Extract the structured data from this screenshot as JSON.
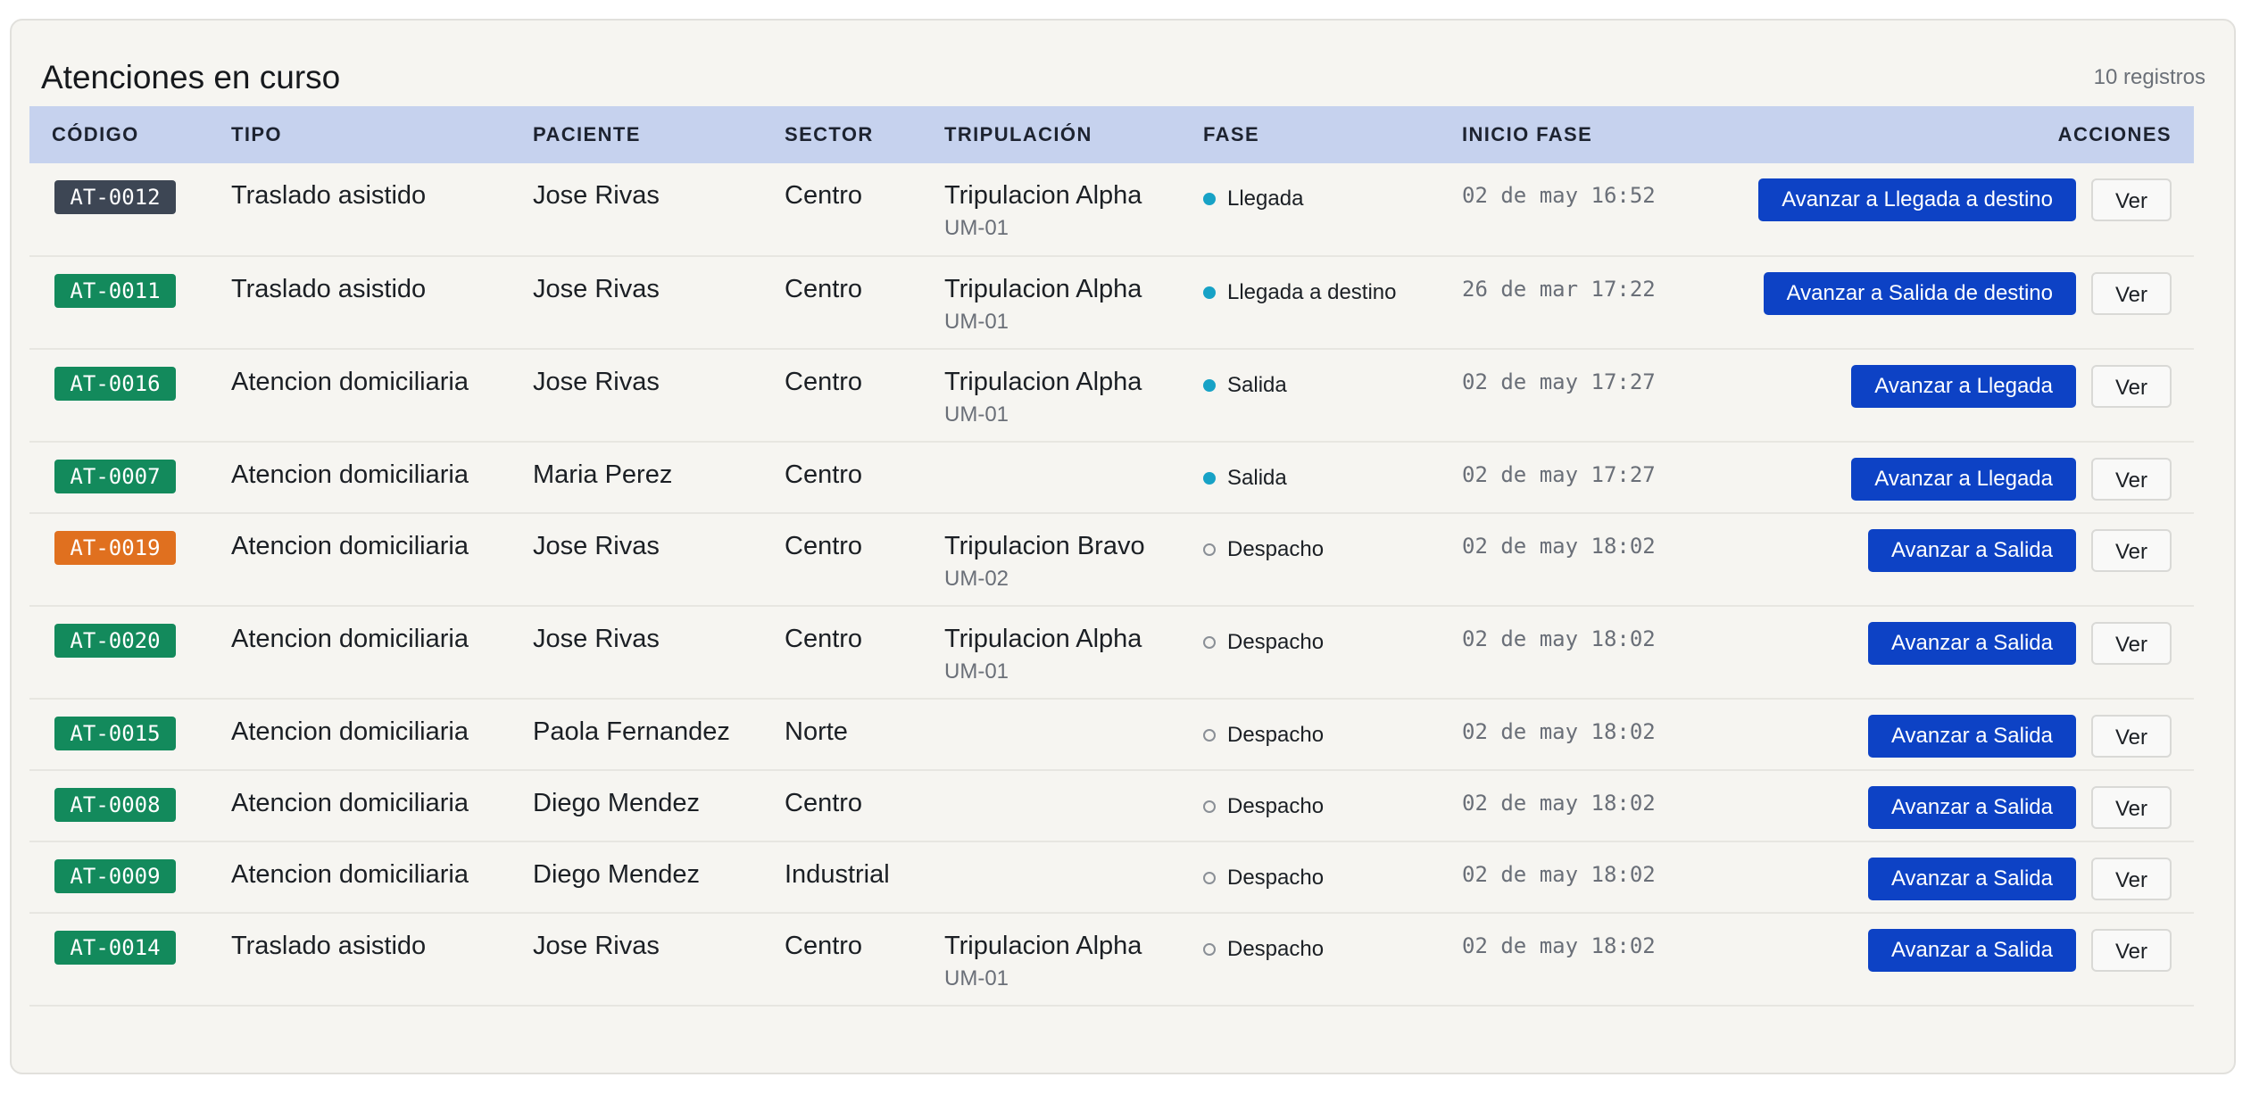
{
  "header": {
    "title": "Atenciones en curso",
    "count": "10 registros"
  },
  "columns": {
    "code": "CÓDIGO",
    "type": "TIPO",
    "patient": "PACIENTE",
    "sector": "SECTOR",
    "crew": "TRIPULACIÓN",
    "phase": "FASE",
    "start": "INICIO FASE",
    "actions": "ACCIONES"
  },
  "colors": {
    "badge_dark": "#3d4654",
    "badge_green": "#138a5c",
    "badge_orange": "#e0701f",
    "primary": "#0d42c5",
    "header_bg": "#c6d2ee",
    "phase_active": "#17a2c6"
  },
  "view_label": "Ver",
  "rows": [
    {
      "code": "AT-0012",
      "badge": "dark",
      "type": "Traslado asistido",
      "patient": "Jose Rivas",
      "sector": "Centro",
      "crew": "Tripulacion Alpha",
      "unit": "UM-01",
      "phase": "Llegada",
      "phase_state": "active",
      "start": "02 de may 16:52",
      "action": "Avanzar a Llegada a destino"
    },
    {
      "code": "AT-0011",
      "badge": "green",
      "type": "Traslado asistido",
      "patient": "Jose Rivas",
      "sector": "Centro",
      "crew": "Tripulacion Alpha",
      "unit": "UM-01",
      "phase": "Llegada a destino",
      "phase_state": "active",
      "start": "26 de mar 17:22",
      "action": "Avanzar a Salida de destino"
    },
    {
      "code": "AT-0016",
      "badge": "green",
      "type": "Atencion domiciliaria",
      "patient": "Jose Rivas",
      "sector": "Centro",
      "crew": "Tripulacion Alpha",
      "unit": "UM-01",
      "phase": "Salida",
      "phase_state": "active",
      "start": "02 de may 17:27",
      "action": "Avanzar a Llegada"
    },
    {
      "code": "AT-0007",
      "badge": "green",
      "type": "Atencion domiciliaria",
      "patient": "Maria Perez",
      "sector": "Centro",
      "crew": "",
      "unit": "",
      "phase": "Salida",
      "phase_state": "active",
      "start": "02 de may 17:27",
      "action": "Avanzar a Llegada"
    },
    {
      "code": "AT-0019",
      "badge": "orange",
      "type": "Atencion domiciliaria",
      "patient": "Jose Rivas",
      "sector": "Centro",
      "crew": "Tripulacion Bravo",
      "unit": "UM-02",
      "phase": "Despacho",
      "phase_state": "pending",
      "start": "02 de may 18:02",
      "action": "Avanzar a Salida"
    },
    {
      "code": "AT-0020",
      "badge": "green",
      "type": "Atencion domiciliaria",
      "patient": "Jose Rivas",
      "sector": "Centro",
      "crew": "Tripulacion Alpha",
      "unit": "UM-01",
      "phase": "Despacho",
      "phase_state": "pending",
      "start": "02 de may 18:02",
      "action": "Avanzar a Salida"
    },
    {
      "code": "AT-0015",
      "badge": "green",
      "type": "Atencion domiciliaria",
      "patient": "Paola Fernandez",
      "sector": "Norte",
      "crew": "",
      "unit": "",
      "phase": "Despacho",
      "phase_state": "pending",
      "start": "02 de may 18:02",
      "action": "Avanzar a Salida"
    },
    {
      "code": "AT-0008",
      "badge": "green",
      "type": "Atencion domiciliaria",
      "patient": "Diego Mendez",
      "sector": "Centro",
      "crew": "",
      "unit": "",
      "phase": "Despacho",
      "phase_state": "pending",
      "start": "02 de may 18:02",
      "action": "Avanzar a Salida"
    },
    {
      "code": "AT-0009",
      "badge": "green",
      "type": "Atencion domiciliaria",
      "patient": "Diego Mendez",
      "sector": "Industrial",
      "crew": "",
      "unit": "",
      "phase": "Despacho",
      "phase_state": "pending",
      "start": "02 de may 18:02",
      "action": "Avanzar a Salida"
    },
    {
      "code": "AT-0014",
      "badge": "green",
      "type": "Traslado asistido",
      "patient": "Jose Rivas",
      "sector": "Centro",
      "crew": "Tripulacion Alpha",
      "unit": "UM-01",
      "phase": "Despacho",
      "phase_state": "pending",
      "start": "02 de may 18:02",
      "action": "Avanzar a Salida"
    }
  ]
}
